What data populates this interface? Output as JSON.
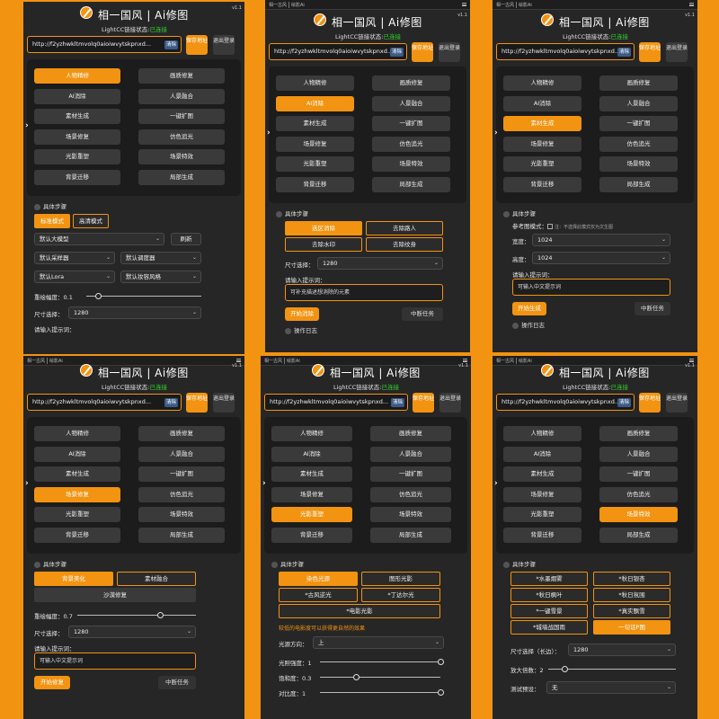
{
  "shared": {
    "tab_a": "相一古风",
    "tab_b": "绘影Ai",
    "version": "v1.1",
    "title": "相一国风 | Ai修图",
    "status_label": "LightCC链接状态:",
    "status_value": "已连接",
    "url": "http://f2yzhwkltmvolq0aioiwvytskpnxd...",
    "url_panel4": "http://f2yzhwkltmvolq0aioiwvytskpnxd...",
    "clear": "清除",
    "save": "保存地址",
    "logout": "退出登录",
    "steps": "具体步骤",
    "log": "操作日志",
    "prompt_label": "请输入提示词：",
    "stop": "中断任务",
    "functions": [
      "人物精修",
      "画质修复",
      "AI消除",
      "人景融合",
      "素材生成",
      "一键扩图",
      "场景修复",
      "仿色追光",
      "光影重塑",
      "场景特效",
      "背景迁移",
      "局部生成"
    ]
  },
  "colors": {
    "accent": "#f29311",
    "panel": "#262626",
    "ok": "#2fd52f"
  },
  "p1": {
    "active": 0,
    "mode_a": "标准模式",
    "mode_b": "高清模式",
    "model": "默认大模型",
    "refresh": "刷新",
    "sampler": "默认采样器",
    "scheduler": "默认调度器",
    "lora": "默认Lora",
    "style": "默认妆容风格",
    "redraw_label": "重绘幅度：0.1",
    "redraw_value": 0.1,
    "size_label": "尺寸选择：",
    "size_value": "1280",
    "prompt_label": "请输入提示词："
  },
  "p2": {
    "active": 2,
    "opts": [
      "选区消除",
      "去除路人",
      "去除水印",
      "去除纹身"
    ],
    "size_label": "尺寸选择：",
    "size_value": "1280",
    "prompt_label": "请输入提示词：",
    "prompt_value": "可补充描述想消除的元素",
    "go": "开始消除"
  },
  "p3": {
    "active": 4,
    "ref_label": "参考图模式：",
    "ref_note": "注：不选择此模式仅为文生图",
    "width_label": "宽度：",
    "width_value": "1024",
    "height_label": "高度：",
    "height_value": "1024",
    "prompt_label": "请输入提示词：",
    "prompt_value": "可输入中文提示词",
    "go": "开始生成"
  },
  "p4": {
    "active": 6,
    "opt_a": "背景美化",
    "opt_b": "素材融合",
    "opt_c": "沙漠修复",
    "redraw_label": "重绘幅度：0.7",
    "redraw_value": 0.7,
    "size_label": "尺寸选择：",
    "size_value": "1280",
    "prompt_label": "请输入提示词：",
    "prompt_value": "可输入中文提示词",
    "go": "开始修复"
  },
  "p5": {
    "active": 8,
    "opts": [
      "染色光源",
      "图形光影",
      "*古风逆光",
      "*丁达尔光",
      "*电影光影"
    ],
    "warn": "较低的电影度可以获得更自然的效果",
    "dir_label": "光源方向：",
    "dir_value": "上",
    "intensity_label": "光照强度：1",
    "intensity_value": 1,
    "saturation_label": "饱和度：0.3",
    "saturation_value": 0.3,
    "contrast_label": "对比度：1",
    "contrast_value": 1
  },
  "p6": {
    "active": 9,
    "opts": [
      "*水墨烟雾",
      "*秋日银杏",
      "*秋日枫叶",
      "*秋日氛围",
      "*一键雪景",
      "*真实飘雪",
      "*城墙战国雨",
      "一句话P图"
    ],
    "size_label": "尺寸选择（长边）：",
    "size_value": "1280",
    "zoom_label": "放大倍数：2",
    "zoom_value": 2,
    "preset_label": "测试预设：",
    "preset_value": "无"
  }
}
